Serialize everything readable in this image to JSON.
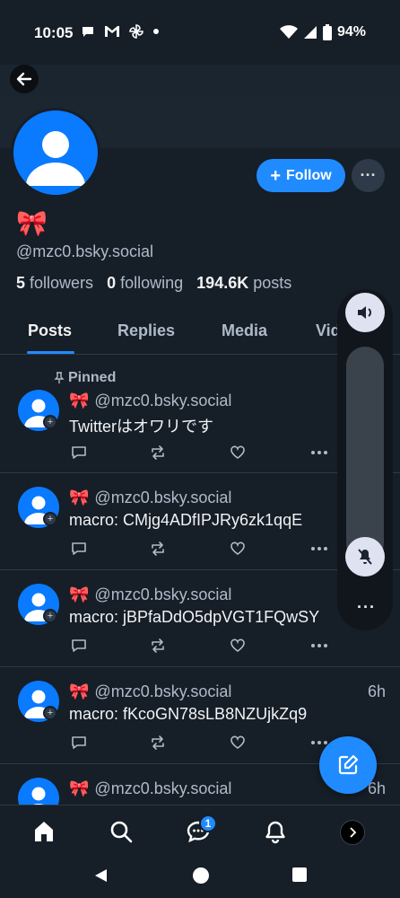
{
  "status_bar": {
    "time": "10:05",
    "battery": "94%",
    "left_icons": [
      "chat-bubble-icon",
      "gmail-icon",
      "pinwheel-icon",
      "dot-icon"
    ],
    "right_icons": [
      "wifi-icon",
      "signal-icon",
      "battery-icon"
    ]
  },
  "profile": {
    "display_name": "🎀",
    "handle": "@mzc0.bsky.social",
    "followers_count": "5",
    "followers_label": "followers",
    "following_count": "0",
    "following_label": "following",
    "posts_count": "194.6K",
    "posts_label": "posts",
    "follow_label": "Follow",
    "more_label": "···"
  },
  "tabs": [
    {
      "label": "Posts",
      "active": true
    },
    {
      "label": "Replies",
      "active": false
    },
    {
      "label": "Media",
      "active": false
    },
    {
      "label": "Vid",
      "active": false
    }
  ],
  "posts": [
    {
      "pinned_label": "Pinned",
      "emoji": "🎀",
      "handle": "@mzc0.bsky.social",
      "time": "",
      "text": "Twitterはオワリです"
    },
    {
      "emoji": "🎀",
      "handle": "@mzc0.bsky.social",
      "time": "",
      "text": "macro: CMjg4ADfIPJRy6zk1qqE"
    },
    {
      "emoji": "🎀",
      "handle": "@mzc0.bsky.social",
      "time": "",
      "text": "macro: jBPfaDdO5dpVGT1FQwSY"
    },
    {
      "emoji": "🎀",
      "handle": "@mzc0.bsky.social",
      "time": "6h",
      "text": "macro: fKcoGN78sLB8NZUjkZq9"
    },
    {
      "emoji": "🎀",
      "handle": "@mzc0.bsky.social",
      "time": "6h",
      "text": ""
    }
  ],
  "post_action_icons": [
    "reply-icon",
    "repost-icon",
    "like-icon",
    "more-icon"
  ],
  "volume_panel": {
    "more_label": "···"
  },
  "bottom_nav": {
    "items": [
      "home-icon",
      "search-icon",
      "chat-icon",
      "notifications-icon",
      "profile-avatar"
    ],
    "chat_badge": "1"
  },
  "colors": {
    "background": "#161e27",
    "accent": "#208bfe",
    "text_primary": "#f1f3f5",
    "text_secondary": "#aebbc9",
    "divider": "#2e3a47"
  }
}
